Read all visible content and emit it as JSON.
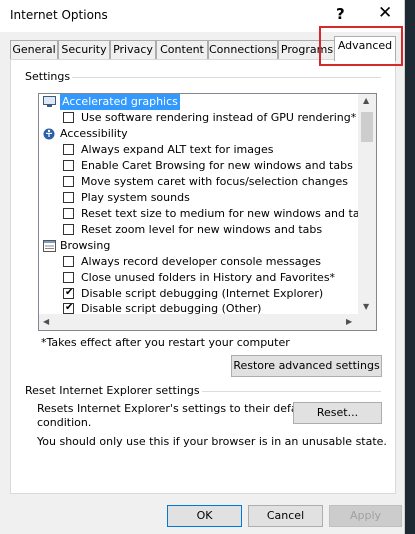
{
  "window": {
    "title": "Internet Options",
    "help_label": "?",
    "close_label": "✕"
  },
  "tabs": [
    {
      "label": "General"
    },
    {
      "label": "Security"
    },
    {
      "label": "Privacy"
    },
    {
      "label": "Content"
    },
    {
      "label": "Connections"
    },
    {
      "label": "Programs"
    },
    {
      "label": "Advanced",
      "active": true
    }
  ],
  "settings": {
    "group_label": "Settings",
    "items": [
      {
        "type": "category",
        "label": "Accelerated graphics",
        "icon": "monitor-icon",
        "selected": true
      },
      {
        "type": "checkbox",
        "label": "Use software rendering instead of GPU rendering*",
        "checked": false
      },
      {
        "type": "category",
        "label": "Accessibility",
        "icon": "accessibility-icon"
      },
      {
        "type": "checkbox",
        "label": "Always expand ALT text for images",
        "checked": false
      },
      {
        "type": "checkbox",
        "label": "Enable Caret Browsing for new windows and tabs",
        "checked": false
      },
      {
        "type": "checkbox",
        "label": "Move system caret with focus/selection changes",
        "checked": false
      },
      {
        "type": "checkbox",
        "label": "Play system sounds",
        "checked": false
      },
      {
        "type": "checkbox",
        "label": "Reset text size to medium for new windows and tabs",
        "checked": false
      },
      {
        "type": "checkbox",
        "label": "Reset zoom level for new windows and tabs",
        "checked": false
      },
      {
        "type": "category",
        "label": "Browsing",
        "icon": "browsing-icon"
      },
      {
        "type": "checkbox",
        "label": "Always record developer console messages",
        "checked": false
      },
      {
        "type": "checkbox",
        "label": "Close unused folders in History and Favorites*",
        "checked": false
      },
      {
        "type": "checkbox",
        "label": "Disable script debugging (Internet Explorer)",
        "checked": true
      },
      {
        "type": "checkbox",
        "label": "Disable script debugging (Other)",
        "checked": true
      }
    ],
    "restart_note": "*Takes effect after you restart your computer",
    "restore_button": "Restore advanced settings"
  },
  "reset": {
    "group_label": "Reset Internet Explorer settings",
    "description_line1": "Resets Internet Explorer's settings to their default",
    "description_line2": "condition.",
    "warning": "You should only use this if your browser is in an unusable state.",
    "reset_button": "Reset..."
  },
  "footer": {
    "ok": "OK",
    "cancel": "Cancel",
    "apply": "Apply",
    "apply_enabled": false
  },
  "colors": {
    "selection": "#3399ff",
    "highlight_box": "#d42a2a"
  }
}
